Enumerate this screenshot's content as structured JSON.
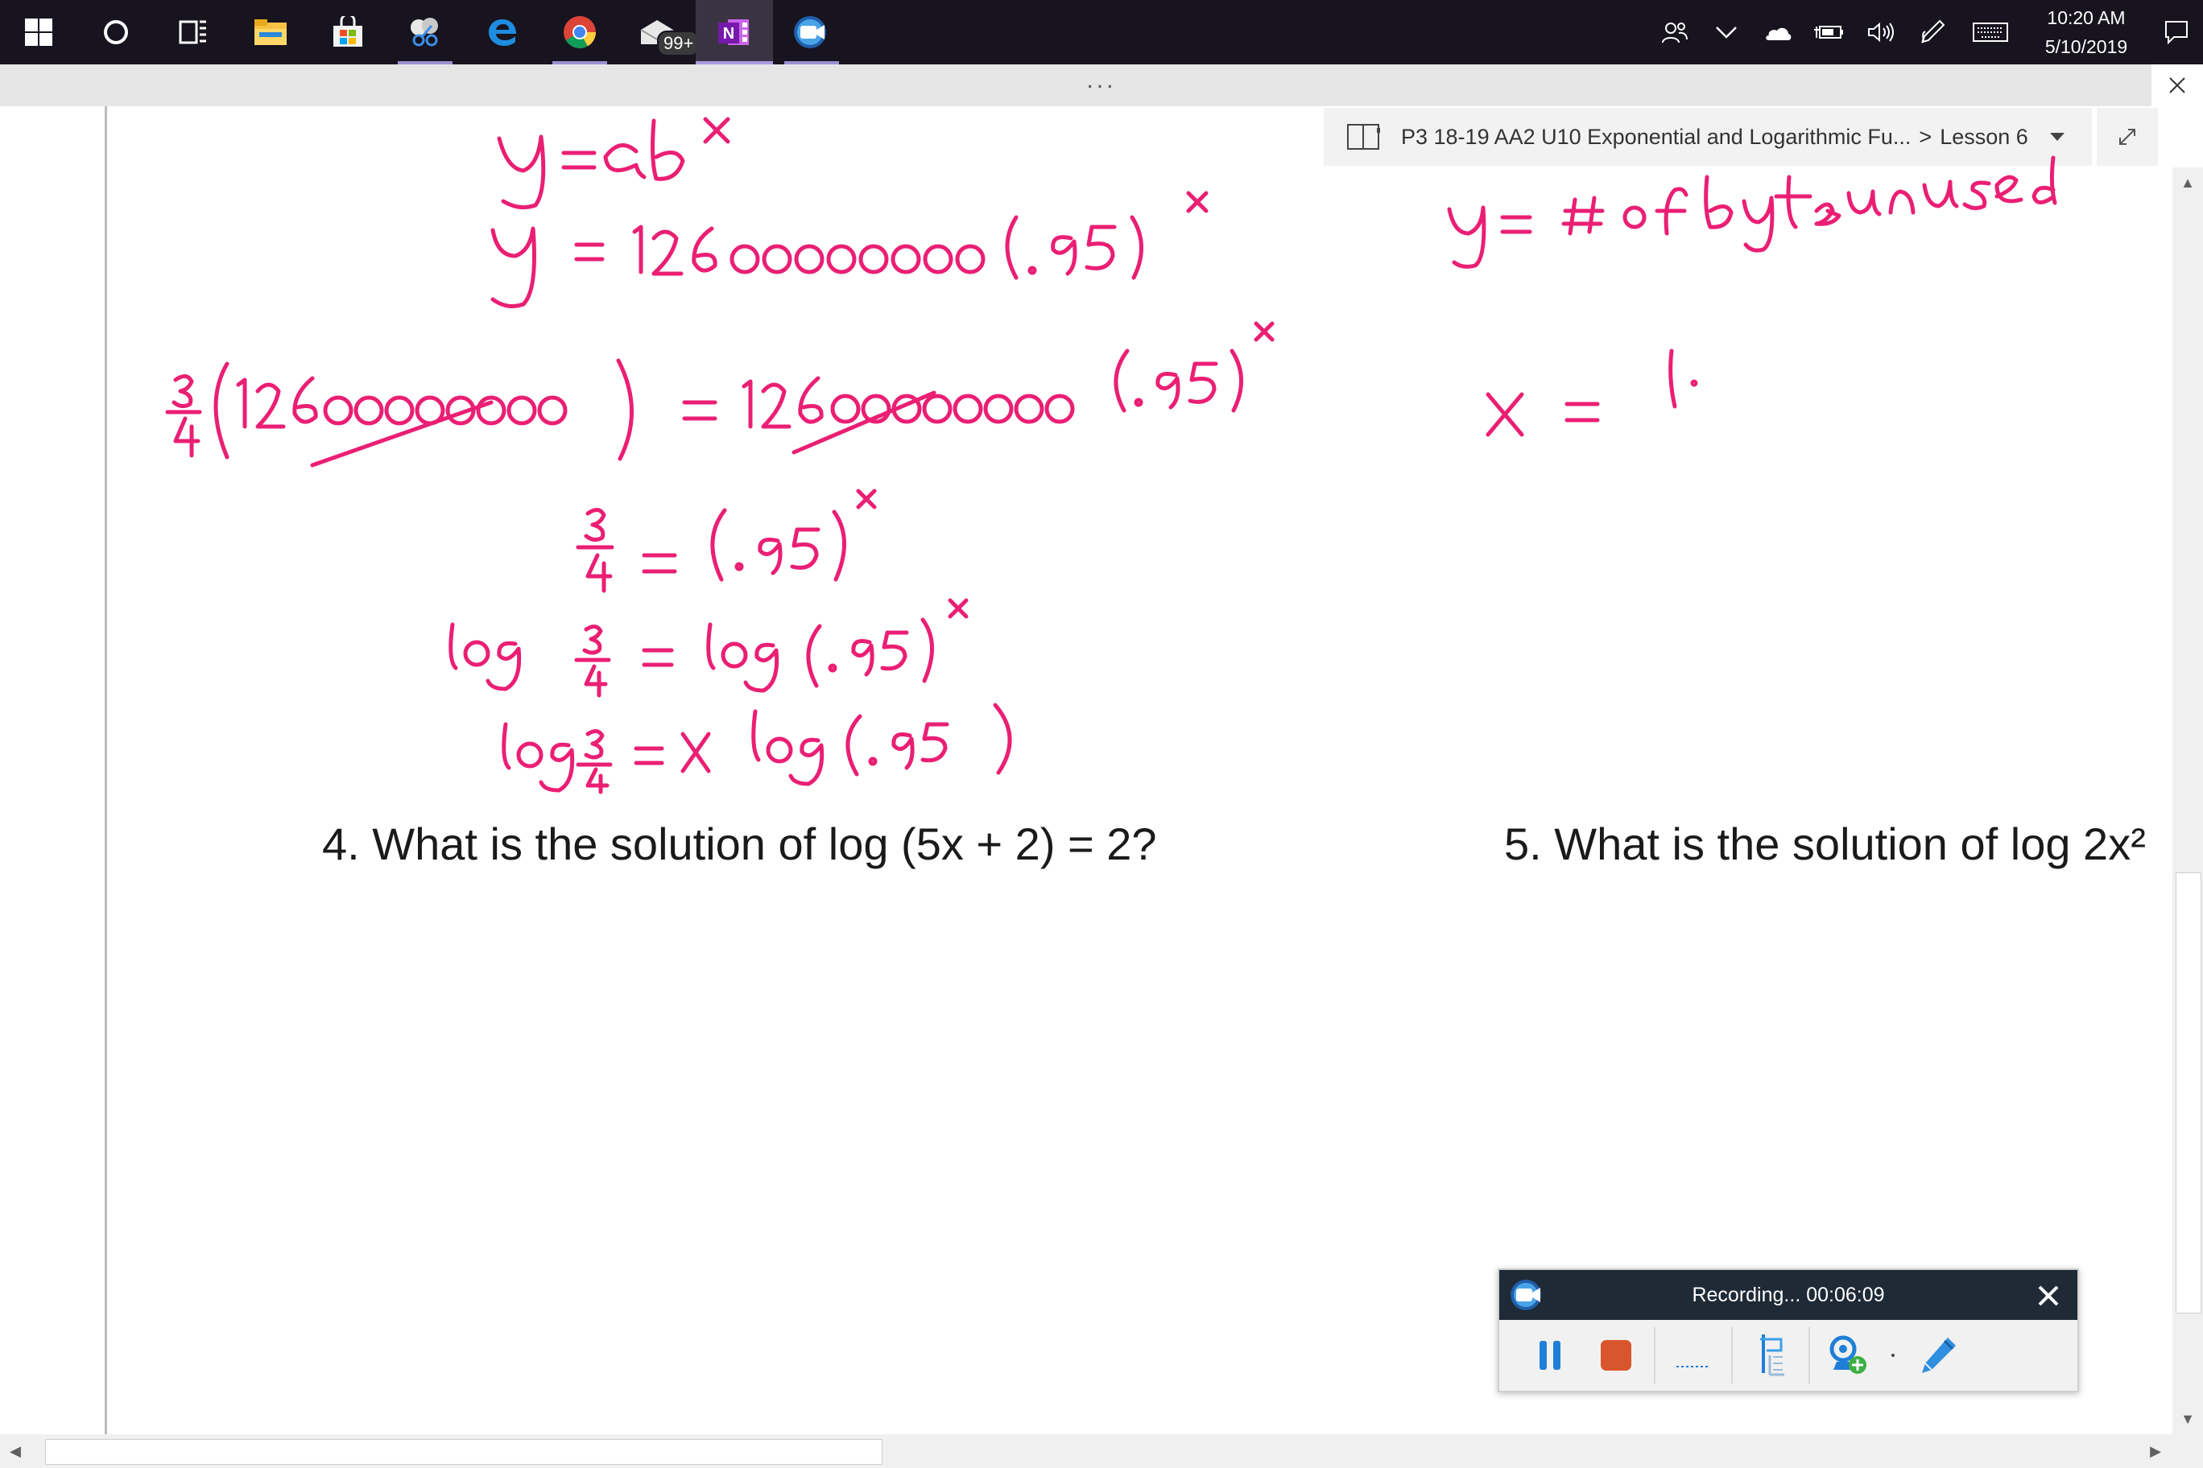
{
  "taskbar": {
    "apps": [
      {
        "icon": "windows-start-icon"
      },
      {
        "icon": "cortana-search-icon"
      },
      {
        "icon": "task-view-icon"
      },
      {
        "icon": "file-explorer-icon"
      },
      {
        "icon": "microsoft-store-icon"
      },
      {
        "icon": "snipping-tool-icon"
      },
      {
        "icon": "edge-browser-icon"
      },
      {
        "icon": "chrome-browser-icon"
      },
      {
        "icon": "mail-icon",
        "badge": "99+"
      },
      {
        "icon": "onenote-icon"
      },
      {
        "icon": "screencast-recorder-icon"
      }
    ],
    "tray": [
      "people-icon",
      "show-hidden-icons-chevron",
      "onedrive-cloud-icon",
      "battery-icon",
      "volume-icon",
      "pen-workspace-icon",
      "touch-keyboard-icon"
    ],
    "time": "10:20 AM",
    "date": "5/10/2019"
  },
  "app": {
    "dots": "...",
    "breadcrumb": {
      "notebook": "P3 18-19 AA2 U10 Exponential and Logarithmic Fu...",
      "separator": ">",
      "page": "Lesson 6"
    }
  },
  "page": {
    "problem4": "4.  What is the solution of log (5x + 2) = 2?",
    "problem5": "5.  What is the solution of log 2x²"
  },
  "ink_color": "#ea1f74",
  "recorder": {
    "status": "Recording... 00:06:09",
    "tools": [
      "pause-icon",
      "stop-icon",
      "dotted-line-icon",
      "crop-tool-icon",
      "webcam-add-icon",
      "pen-annotate-icon"
    ]
  }
}
